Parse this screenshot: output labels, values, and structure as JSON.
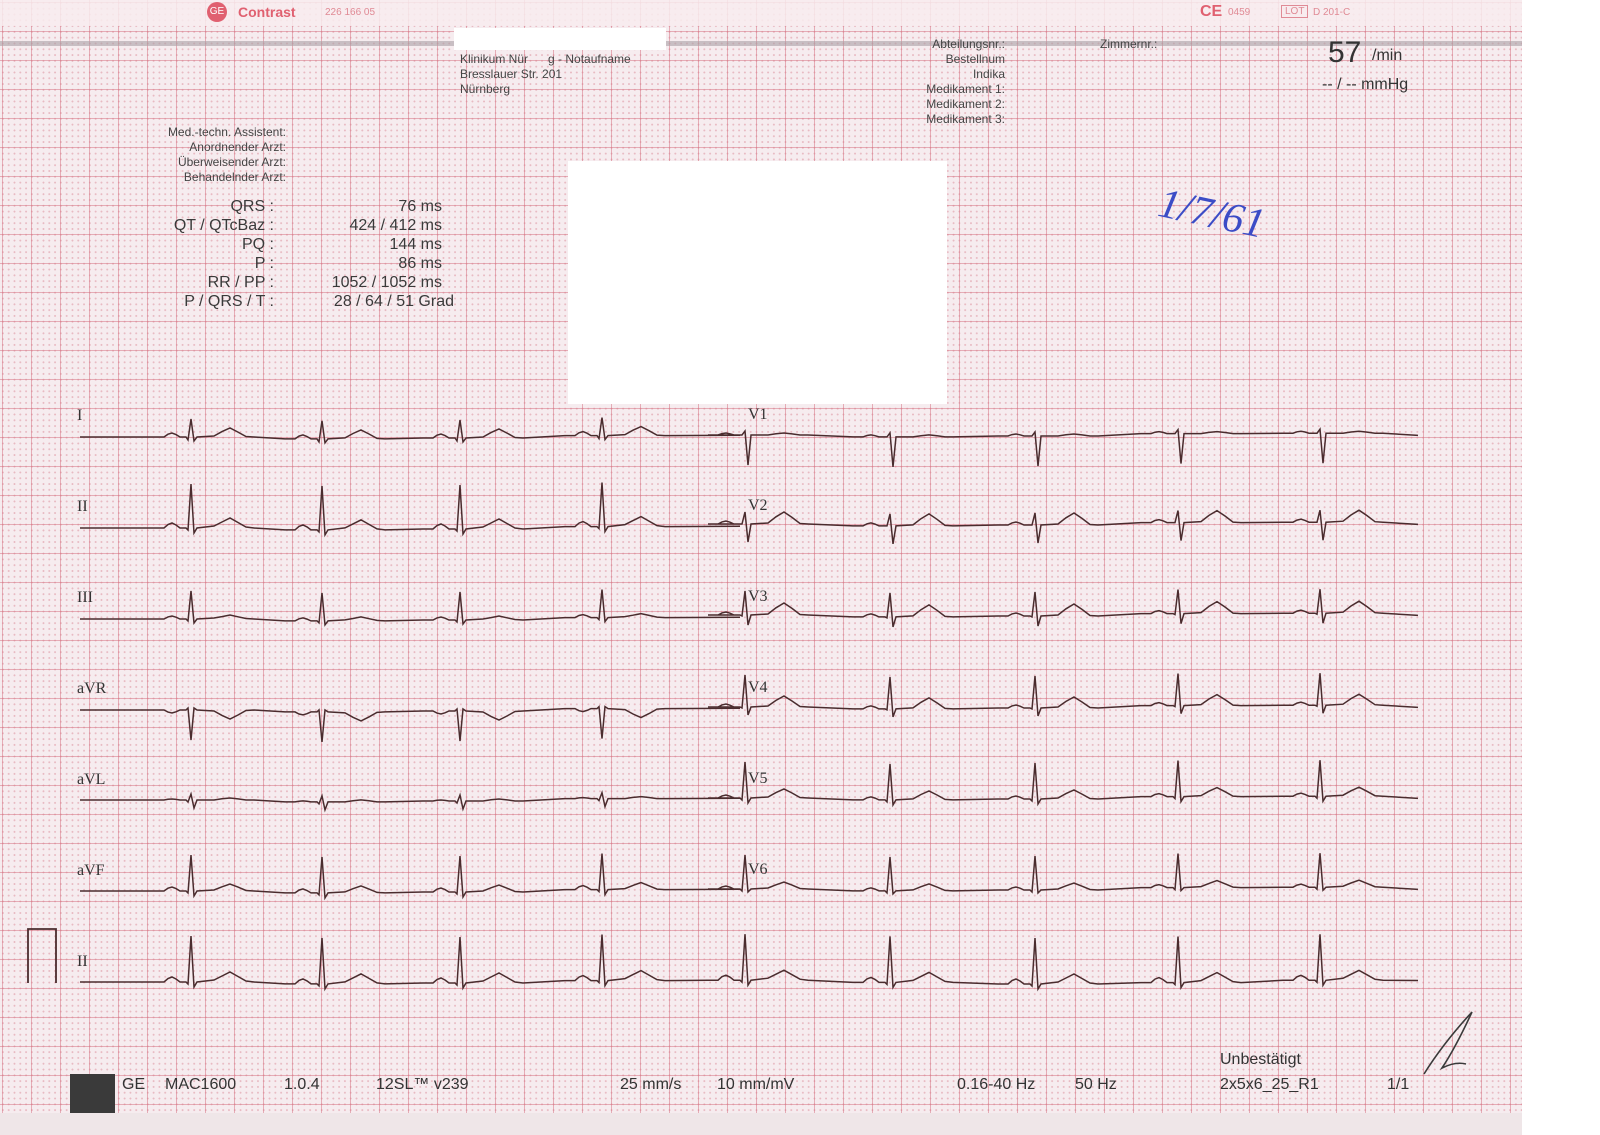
{
  "header": {
    "brand": "Contrast",
    "catalog_number": "226 166 05",
    "ce_number": "0459",
    "lot_label": "LOT",
    "lot_number": "D 201-C",
    "institution_line1": "Klinikum Nür      g - Notaufname",
    "institution_line2": "Bresslauer Str. 201",
    "institution_line3": "Nürnberg",
    "order_fields": [
      "Abteilungsnr.:",
      "Bestellnum",
      "Indika",
      "Medikament 1:",
      "Medikament 2:",
      "Medikament 3:"
    ],
    "room_label": "Zimmernr.:",
    "heart_rate_value": "57",
    "heart_rate_unit": "/min",
    "blood_pressure": "-- / -- mmHg"
  },
  "staff": {
    "labels": [
      "Med.-techn. Assistent:",
      "Anordnender Arzt:",
      "Überweisender Arzt:",
      "Behandelnder Arzt:"
    ]
  },
  "measurements": [
    {
      "label": "QRS :",
      "value": "76 ms"
    },
    {
      "label": "QT / QTcBaz :",
      "value": "424 / 412 ms"
    },
    {
      "label": "PQ :",
      "value": "144 ms"
    },
    {
      "label": "P :",
      "value": "86 ms"
    },
    {
      "label": "RR / PP :",
      "value": "1052 / 1052 ms"
    },
    {
      "label": "P / QRS / T :",
      "value": "28 / 64 / 51 Grad"
    }
  ],
  "handwritten_note": "1/7/61",
  "leads": {
    "left": [
      "I",
      "II",
      "III",
      "aVR",
      "aVL",
      "aVF"
    ],
    "right": [
      "V1",
      "V2",
      "V3",
      "V4",
      "V5",
      "V6"
    ],
    "rhythm": "II"
  },
  "footer": {
    "vendor": "GE",
    "model": "MAC1600",
    "version": "1.0.4",
    "program": "12SL™ v239",
    "paper_speed": "25 mm/s",
    "gain": "10 mm/mV",
    "filter": "0.16-40 Hz",
    "mains": "50 Hz",
    "status": "Unbestätigt",
    "format": "2x5x6_25_R1",
    "page": "1/1"
  },
  "colors": {
    "trace": "#4a2c2e",
    "grid": "#d77887",
    "paper": "#f6ecef",
    "handwriting": "#3b4cc6"
  }
}
